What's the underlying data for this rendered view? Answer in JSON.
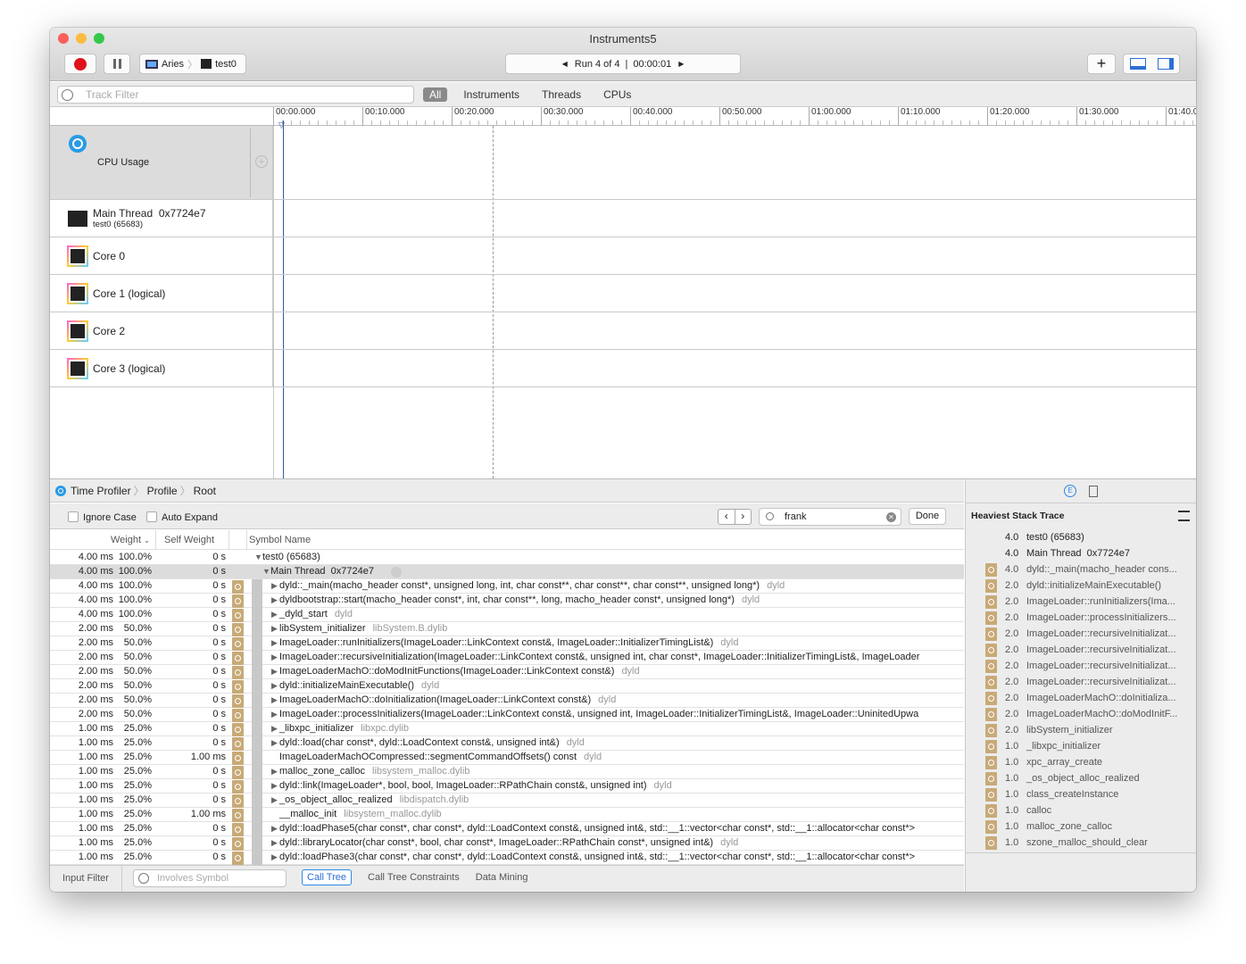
{
  "window": {
    "title": "Instruments5"
  },
  "toolbar": {
    "device": "Aries",
    "target": "test0",
    "run": "Run 4 of 4",
    "run_time": "00:00:01"
  },
  "filter": {
    "placeholder": "Track Filter",
    "tabs": [
      "All",
      "Instruments",
      "Threads",
      "CPUs"
    ],
    "active": "All"
  },
  "ruler": {
    "ticks": [
      "00:00.000",
      "00:10.000",
      "00:20.000",
      "00:30.000",
      "00:40.000",
      "00:50.000",
      "01:00.000",
      "01:10.000",
      "01:20.000",
      "01:30.000",
      "01:40.0"
    ]
  },
  "tracks": {
    "cpu": "CPU Usage",
    "main_thread": "Main Thread  0x7724e7",
    "main_thread_sub": "test0 (65683)",
    "cores": [
      "Core 0",
      "Core 1 (logical)",
      "Core 2",
      "Core 3 (logical)"
    ]
  },
  "breadcrumb": [
    "Time Profiler",
    "Profile",
    "Root"
  ],
  "options": {
    "ignore_case": "Ignore Case",
    "auto_expand": "Auto Expand",
    "search_value": "frank",
    "done": "Done"
  },
  "columns": {
    "weight": "Weight",
    "self_weight": "Self Weight",
    "symbol": "Symbol Name"
  },
  "rows": [
    {
      "w": "4.00 ms",
      "p": "100.0%",
      "s": "0 s",
      "icon": false,
      "lvl": 0,
      "exp": "▼",
      "sym": "test0 (65683)",
      "lib": ""
    },
    {
      "w": "4.00 ms",
      "p": "100.0%",
      "s": "0 s",
      "icon": false,
      "lvl": 1,
      "exp": "▼",
      "sym": "Main Thread  0x7724e7",
      "lib": "",
      "sel": true
    },
    {
      "w": "4.00 ms",
      "p": "100.0%",
      "s": "0 s",
      "icon": true,
      "lvl": 2,
      "exp": "▶",
      "sym": "dyld::_main(macho_header const*, unsigned long, int, char const**, char const**, char const**, unsigned long*)",
      "lib": "dyld"
    },
    {
      "w": "4.00 ms",
      "p": "100.0%",
      "s": "0 s",
      "icon": true,
      "lvl": 2,
      "exp": "▶",
      "sym": "dyldbootstrap::start(macho_header const*, int, char const**, long, macho_header const*, unsigned long*)",
      "lib": "dyld"
    },
    {
      "w": "4.00 ms",
      "p": "100.0%",
      "s": "0 s",
      "icon": true,
      "lvl": 2,
      "exp": "▶",
      "sym": "_dyld_start",
      "lib": "dyld"
    },
    {
      "w": "2.00 ms",
      "p": "50.0%",
      "s": "0 s",
      "icon": true,
      "lvl": 2,
      "exp": "▶",
      "sym": "libSystem_initializer",
      "lib": "libSystem.B.dylib"
    },
    {
      "w": "2.00 ms",
      "p": "50.0%",
      "s": "0 s",
      "icon": true,
      "lvl": 2,
      "exp": "▶",
      "sym": "ImageLoader::runInitializers(ImageLoader::LinkContext const&, ImageLoader::InitializerTimingList&)",
      "lib": "dyld"
    },
    {
      "w": "2.00 ms",
      "p": "50.0%",
      "s": "0 s",
      "icon": true,
      "lvl": 2,
      "exp": "▶",
      "sym": "ImageLoader::recursiveInitialization(ImageLoader::LinkContext const&, unsigned int, char const*, ImageLoader::InitializerTimingList&, ImageLoader",
      "lib": ""
    },
    {
      "w": "2.00 ms",
      "p": "50.0%",
      "s": "0 s",
      "icon": true,
      "lvl": 2,
      "exp": "▶",
      "sym": "ImageLoaderMachO::doModInitFunctions(ImageLoader::LinkContext const&)",
      "lib": "dyld"
    },
    {
      "w": "2.00 ms",
      "p": "50.0%",
      "s": "0 s",
      "icon": true,
      "lvl": 2,
      "exp": "▶",
      "sym": "dyld::initializeMainExecutable()",
      "lib": "dyld"
    },
    {
      "w": "2.00 ms",
      "p": "50.0%",
      "s": "0 s",
      "icon": true,
      "lvl": 2,
      "exp": "▶",
      "sym": "ImageLoaderMachO::doInitialization(ImageLoader::LinkContext const&)",
      "lib": "dyld"
    },
    {
      "w": "2.00 ms",
      "p": "50.0%",
      "s": "0 s",
      "icon": true,
      "lvl": 2,
      "exp": "▶",
      "sym": "ImageLoader::processInitializers(ImageLoader::LinkContext const&, unsigned int, ImageLoader::InitializerTimingList&, ImageLoader::UninitedUpwa",
      "lib": ""
    },
    {
      "w": "1.00 ms",
      "p": "25.0%",
      "s": "0 s",
      "icon": true,
      "lvl": 2,
      "exp": "▶",
      "sym": "_libxpc_initializer",
      "lib": "libxpc.dylib"
    },
    {
      "w": "1.00 ms",
      "p": "25.0%",
      "s": "0 s",
      "icon": true,
      "lvl": 2,
      "exp": "▶",
      "sym": "dyld::load(char const*, dyld::LoadContext const&, unsigned int&)",
      "lib": "dyld"
    },
    {
      "w": "1.00 ms",
      "p": "25.0%",
      "s": "1.00 ms",
      "icon": true,
      "lvl": 2,
      "exp": "",
      "sym": "ImageLoaderMachOCompressed::segmentCommandOffsets() const",
      "lib": "dyld"
    },
    {
      "w": "1.00 ms",
      "p": "25.0%",
      "s": "0 s",
      "icon": true,
      "lvl": 2,
      "exp": "▶",
      "sym": "malloc_zone_calloc",
      "lib": "libsystem_malloc.dylib"
    },
    {
      "w": "1.00 ms",
      "p": "25.0%",
      "s": "0 s",
      "icon": true,
      "lvl": 2,
      "exp": "▶",
      "sym": "dyld::link(ImageLoader*, bool, bool, ImageLoader::RPathChain const&, unsigned int)",
      "lib": "dyld"
    },
    {
      "w": "1.00 ms",
      "p": "25.0%",
      "s": "0 s",
      "icon": true,
      "lvl": 2,
      "exp": "▶",
      "sym": "_os_object_alloc_realized",
      "lib": "libdispatch.dylib"
    },
    {
      "w": "1.00 ms",
      "p": "25.0%",
      "s": "1.00 ms",
      "icon": true,
      "lvl": 2,
      "exp": "",
      "sym": "__malloc_init",
      "lib": "libsystem_malloc.dylib"
    },
    {
      "w": "1.00 ms",
      "p": "25.0%",
      "s": "0 s",
      "icon": true,
      "lvl": 2,
      "exp": "▶",
      "sym": "dyld::loadPhase5(char const*, char const*, dyld::LoadContext const&, unsigned int&, std::__1::vector<char const*, std::__1::allocator<char const*>",
      "lib": ""
    },
    {
      "w": "1.00 ms",
      "p": "25.0%",
      "s": "0 s",
      "icon": true,
      "lvl": 2,
      "exp": "▶",
      "sym": "dyld::libraryLocator(char const*, bool, char const*, ImageLoader::RPathChain const*, unsigned int&)",
      "lib": "dyld"
    },
    {
      "w": "1.00 ms",
      "p": "25.0%",
      "s": "0 s",
      "icon": true,
      "lvl": 2,
      "exp": "▶",
      "sym": "dyld::loadPhase3(char const*, char const*, dyld::LoadContext const&, unsigned int&, std::__1::vector<char const*, std::__1::allocator<char const*>",
      "lib": ""
    }
  ],
  "bottom_bar": {
    "input_filter": "Input Filter",
    "involves_placeholder": "Involves Symbol",
    "tabs": [
      "Call Tree",
      "Call Tree Constraints",
      "Data Mining"
    ],
    "active": "Call Tree"
  },
  "heaviest": {
    "title": "Heaviest Stack Trace",
    "items": [
      {
        "v": "4.0",
        "n": "test0 (65683)",
        "icon": false
      },
      {
        "v": "4.0",
        "n": "Main Thread  0x7724e7",
        "icon": false
      },
      {
        "v": "4.0",
        "n": "dyld::_main(macho_header cons...",
        "icon": true
      },
      {
        "v": "2.0",
        "n": "dyld::initializeMainExecutable()",
        "icon": true
      },
      {
        "v": "2.0",
        "n": "ImageLoader::runInitializers(Ima...",
        "icon": true
      },
      {
        "v": "2.0",
        "n": "ImageLoader::processInitializers...",
        "icon": true
      },
      {
        "v": "2.0",
        "n": "ImageLoader::recursiveInitializat...",
        "icon": true
      },
      {
        "v": "2.0",
        "n": "ImageLoader::recursiveInitializat...",
        "icon": true
      },
      {
        "v": "2.0",
        "n": "ImageLoader::recursiveInitializat...",
        "icon": true
      },
      {
        "v": "2.0",
        "n": "ImageLoader::recursiveInitializat...",
        "icon": true
      },
      {
        "v": "2.0",
        "n": "ImageLoaderMachO::doInitializa...",
        "icon": true
      },
      {
        "v": "2.0",
        "n": "ImageLoaderMachO::doModInitF...",
        "icon": true
      },
      {
        "v": "2.0",
        "n": "libSystem_initializer",
        "icon": true
      },
      {
        "v": "1.0",
        "n": "_libxpc_initializer",
        "icon": true
      },
      {
        "v": "1.0",
        "n": "xpc_array_create",
        "icon": true
      },
      {
        "v": "1.0",
        "n": "_os_object_alloc_realized",
        "icon": true
      },
      {
        "v": "1.0",
        "n": "class_createInstance",
        "icon": true
      },
      {
        "v": "1.0",
        "n": "calloc",
        "icon": true
      },
      {
        "v": "1.0",
        "n": "malloc_zone_calloc",
        "icon": true
      },
      {
        "v": "1.0",
        "n": "szone_malloc_should_clear",
        "icon": true
      }
    ]
  },
  "colors": {
    "record": "#e0111b",
    "accent": "#2a8ae6",
    "gear": "#c8aa78"
  }
}
